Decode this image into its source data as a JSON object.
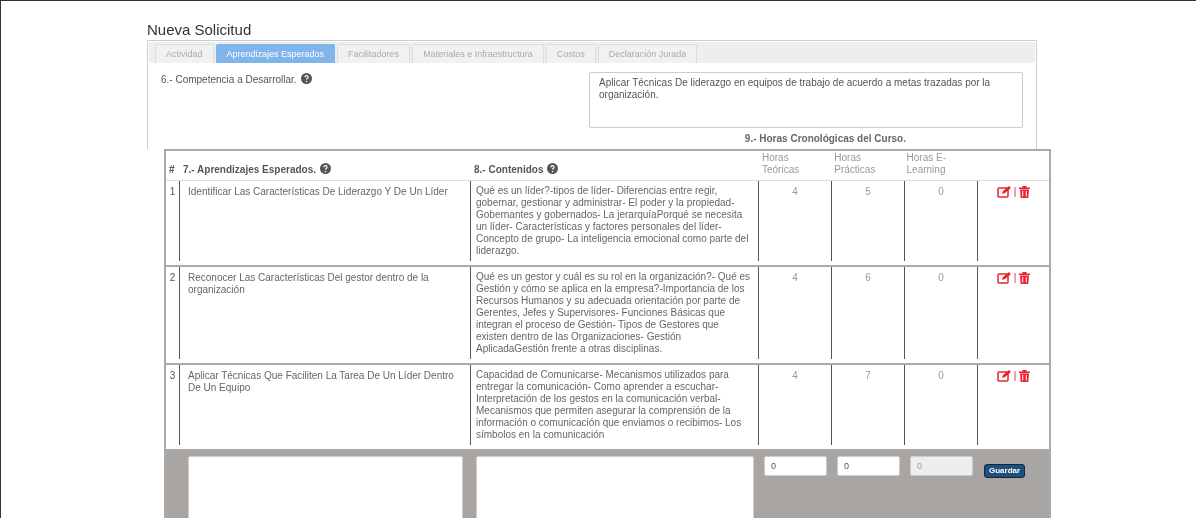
{
  "page_title": "Nueva Solicitud",
  "tabs": [
    {
      "label": "Actividad",
      "selected": false
    },
    {
      "label": "Aprendizajes Esperados",
      "selected": true
    },
    {
      "label": "Facilitadores",
      "selected": false
    },
    {
      "label": "Materiales e Infraestructura",
      "selected": false
    },
    {
      "label": "Costos",
      "selected": false
    },
    {
      "label": "Declaración Jurada",
      "selected": false
    }
  ],
  "competencia": {
    "label": "6.- Competencia a Desarrollar.",
    "value": "Aplicar Técnicas De liderazgo en equipos de trabajo de acuerdo a metas trazadas por la organización."
  },
  "hours_caption": "9.- Horas Cronológicas del Curso.",
  "table": {
    "columns": [
      {
        "label": "#",
        "help": false
      },
      {
        "label": "7.- Aprendizajes Esperados.",
        "help": true
      },
      {
        "label": "8.- Contenidos",
        "help": true
      },
      {
        "label": "Horas Teóricas",
        "help": false
      },
      {
        "label": "Horas Prácticas",
        "help": false
      },
      {
        "label": "Horas E-Learning",
        "help": false
      }
    ],
    "rows": [
      {
        "number": "1",
        "aprendizaje": "Identificar Las Características De Liderazgo Y De Un Líder",
        "contenidos": "Qué es un líder?-tipos de líder- Diferencias entre regir, gobernar, gestionar y administrar- El poder y la propiedad-Gobernantes y gobernados- La jerarquíaPorqué se necesita un líder- Características y factores personales del líder- Concepto de grupo- La inteligencia emocional como parte del liderazgo.",
        "teoricas": "4",
        "practicas": "5",
        "elearning": "0",
        "separator": "|"
      },
      {
        "number": "2",
        "aprendizaje": "Reconocer Las Características Del gestor dentro de la organización",
        "contenidos": "Qué es un gestor y cuál es su rol en la organización?- Qué es Gestión y cómo se aplica en la empresa?-Importancia de los Recursos Humanos y su adecuada orientación por parte de Gerentes, Jefes y Supervisores- Funciones Básicas que integran el proceso de Gestión- Tipos de Gestores que existen dentro de las Organizaciones- Gestión AplicadaGestión frente a otras disciplinas.",
        "teoricas": "4",
        "practicas": "6",
        "elearning": "0",
        "separator": "|"
      },
      {
        "number": "3",
        "aprendizaje": "Aplicar Técnicas Que Faciliten La Tarea De Un Líder Dentro De Un Equipo",
        "contenidos": "Capacidad de Comunicarse- Mecanismos utilizados para entregar la comunicación- Como aprender a escuchar-Interpretación de los gestos en la comunicación verbal-Mecanismos que permiten asegurar la comprensión de la información o comunicación que enviamos o recibimos- Los símbolos en la comunicación",
        "teoricas": "4",
        "practicas": "7",
        "elearning": "0",
        "separator": "|"
      }
    ],
    "new_row": {
      "hours": [
        {
          "value": "0",
          "disabled": false
        },
        {
          "value": "0",
          "disabled": false
        },
        {
          "value": "0",
          "disabled": true
        }
      ],
      "button": "Guardar"
    }
  }
}
